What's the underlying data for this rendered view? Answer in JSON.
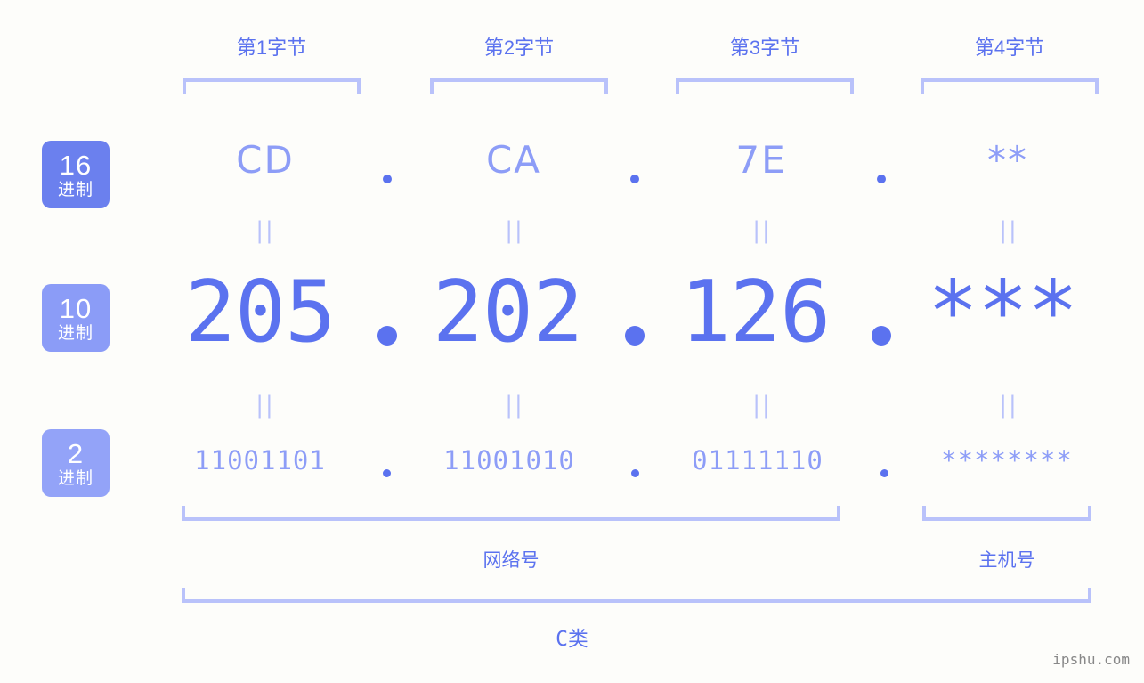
{
  "background": "#fdfdfa",
  "colors": {
    "accent_strong": "#5b72ef",
    "accent_mid": "#8d9df7",
    "accent_light": "#b9c2fa",
    "badge_16": "#6b80ee",
    "badge_10": "#8b9cf7",
    "badge_2": "#93a3f8",
    "watermark": "#888888"
  },
  "byte_headers": [
    {
      "label": "第1字节"
    },
    {
      "label": "第2字节"
    },
    {
      "label": "第3字节"
    },
    {
      "label": "第4字节"
    }
  ],
  "radix_badges": [
    {
      "num": "16",
      "unit": "进制"
    },
    {
      "num": "10",
      "unit": "进制"
    },
    {
      "num": "2",
      "unit": "进制"
    }
  ],
  "rows": {
    "hex": {
      "values": [
        "CD",
        "CA",
        "7E",
        "**"
      ]
    },
    "decimal": {
      "values": [
        "205",
        "202",
        "126",
        "***"
      ]
    },
    "binary": {
      "values": [
        "11001101",
        "11001010",
        "01111110",
        "********"
      ]
    }
  },
  "separators": {
    "dot": ".",
    "equals": "||"
  },
  "sections": [
    {
      "label": "网络号"
    },
    {
      "label": "主机号"
    }
  ],
  "class_label": "C类",
  "watermark": "ipshu.com"
}
